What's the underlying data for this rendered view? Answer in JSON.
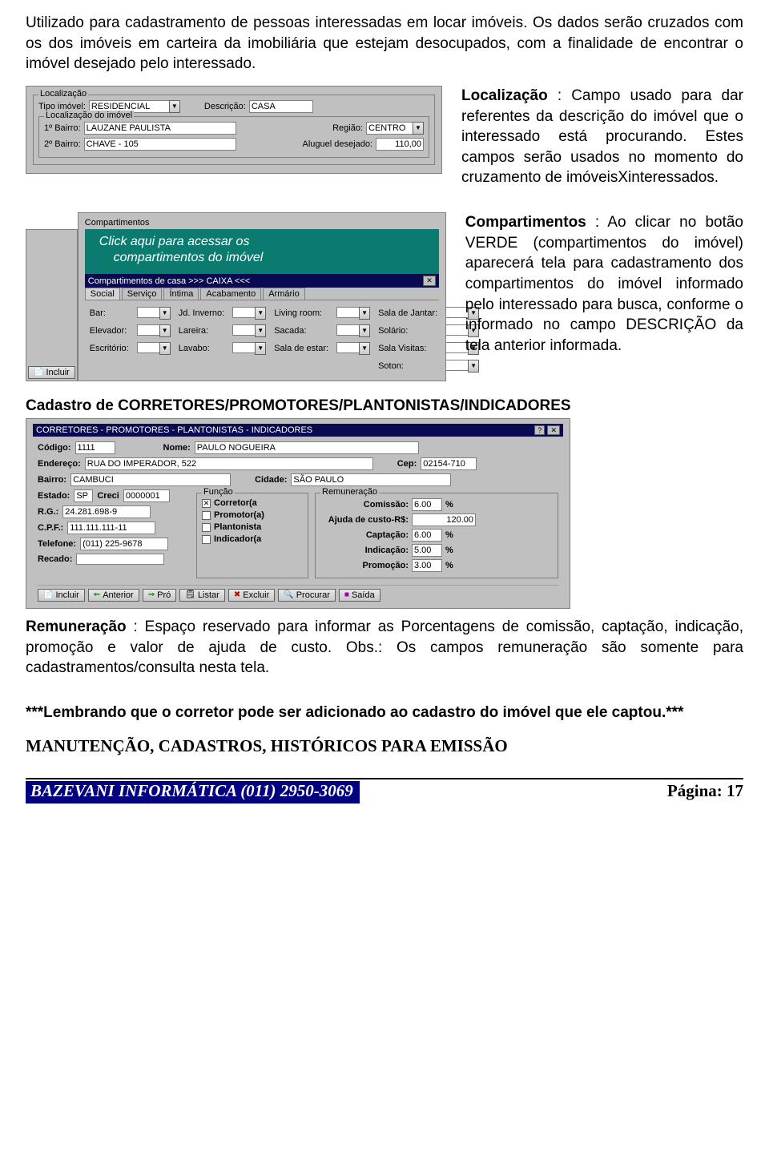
{
  "para1": "Utilizado para cadastramento de  pessoas interessadas em locar imóveis. Os dados serão cruzados com os dos imóveis em carteira da imobiliária que estejam desocupados, com a finalidade de encontrar o imóvel desejado  pelo interessado.",
  "localizacao_form": {
    "group1_legend": "Localização",
    "tipo_label": "Tipo imóvel:",
    "tipo_value": "RESIDENCIAL",
    "descricao_label": "Descrição:",
    "descricao_value": "CASA",
    "group2_legend": "Localização do imóvel",
    "bairro1_label": "1º Bairro:",
    "bairro1_value": "LAUZANE PAULISTA",
    "regiao_label": "Região:",
    "regiao_value": "CENTRO",
    "bairro2_label": "2º Bairro:",
    "bairro2_value": "CHAVE - 105",
    "aluguel_label": "Aluguel desejado:",
    "aluguel_value": "110,00"
  },
  "para_localizacao_label": "Localização",
  "para_localizacao_rest": " : Campo usado para dar referentes da descrição do imóvel que o interessado está procurando. Estes campos serão usados no momento do cruzamento de imóveisXinteressados.",
  "compart_form": {
    "section_label": "Compartimentos",
    "green_button_line1": "Click aqui para acessar os",
    "green_button_line2": "compartimentos do imóvel",
    "title": "Compartimentos de casa  >>> CAIXA <<<",
    "tabs": [
      "Social",
      "Serviço",
      "Íntima",
      "Acabamento",
      "Armário"
    ],
    "incluir_label": "Incluir",
    "rows": [
      [
        "Bar:",
        "Jd. Inverno:",
        "Living room:",
        "Sala de Jantar:"
      ],
      [
        "Elevador:",
        "Lareira:",
        "Sacada:",
        "Solário:"
      ],
      [
        "Escritório:",
        "Lavabo:",
        "Sala de estar:",
        "Sala Visitas:"
      ]
    ],
    "last_label": "Soton:"
  },
  "para_compart_label": "Compartimentos",
  "para_compart_rest": " : Ao clicar no botão VERDE (compartimentos do imóvel)  aparecerá tela para cadastramento dos compartimentos do imóvel informado pelo interessado para busca, conforme o informado no campo DESCRIÇÃO da tela anterior informada.",
  "cad_title": "Cadastro de CORRETORES/PROMOTORES/PLANTONISTAS/INDICADORES",
  "corretores": {
    "title": "CORRETORES - PROMOTORES - PLANTONISTAS - INDICADORES",
    "codigo_label": "Código:",
    "codigo": "1111",
    "nome_label": "Nome:",
    "nome": "PAULO NOGUEIRA",
    "endereco_label": "Endereço:",
    "endereco": "RUA DO IMPERADOR, 522",
    "cep_label": "Cep:",
    "cep": "02154-710",
    "bairro_label": "Bairro:",
    "bairro": "CAMBUCI",
    "cidade_label": "Cidade:",
    "cidade": "SÃO PAULO",
    "estado_label": "Estado:",
    "estado": "SP",
    "creci_label": "Creci",
    "creci": "0000001",
    "rg_label": "R.G.:",
    "rg": "24.281.698-9",
    "cpf_label": "C.P.F.:",
    "cpf": "111.111.111-11",
    "tel_label": "Telefone:",
    "tel": "(011) 225-9678",
    "recado_label": "Recado:",
    "recado": "",
    "funcao_legend": "Função",
    "funcoes": [
      "Corretor(a",
      "Promotor(a)",
      "Plantonista",
      "Indicador(a"
    ],
    "remun_legend": "Remuneração",
    "comissao_label": "Comissão:",
    "comissao": "6.00",
    "pct": "%",
    "ajuda_label": "Ajuda de custo-R$:",
    "ajuda": "120.00",
    "captacao_label": "Captação:",
    "captacao": "6.00",
    "indicacao_label": "Indicação:",
    "indicacao": "5.00",
    "promocao_label": "Promoção:",
    "promocao": "3.00",
    "buttons": [
      {
        "icon": "📄",
        "icon_name": "new-doc-icon",
        "label": "Incluir"
      },
      {
        "icon": "⇐",
        "icon_name": "arrow-left-icon",
        "label": "Anterior"
      },
      {
        "icon": "⇒",
        "icon_name": "arrow-right-icon",
        "label": "Pró"
      },
      {
        "icon": "🗒",
        "icon_name": "list-icon",
        "label": "Listar"
      },
      {
        "icon": "✖",
        "icon_name": "delete-icon",
        "label": "Excluir"
      },
      {
        "icon": "🔍",
        "icon_name": "search-icon",
        "label": "Procurar"
      },
      {
        "icon": "■",
        "icon_name": "exit-icon",
        "label": "Saída"
      }
    ]
  },
  "para_remun_label": "Remuneração",
  "para_remun_rest": " : Espaço reservado para informar  as Porcentagens de comissão, captação, indicação, promoção e  valor de ajuda de custo. Obs.: Os campos remuneração são somente para cadastramentos/consulta nesta tela.",
  "para_lembrando": "***Lembrando que o corretor pode ser adicionado ao cadastro do imóvel que ele captou.***",
  "para_manut": "MANUTENÇÃO, CADASTROS, HISTÓRICOS  PARA EMISSÃO",
  "footer_left": "BAZEVANI INFORMÁTICA   (011) 2950-3069",
  "footer_right": "Página: 17"
}
